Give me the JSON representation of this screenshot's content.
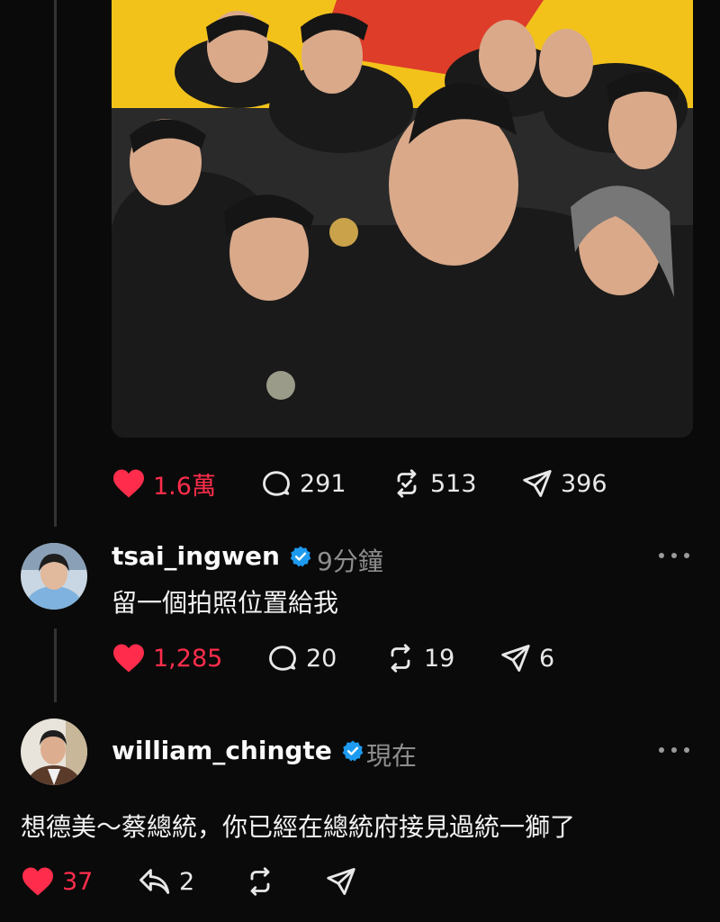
{
  "post": {
    "photo_alt_icon": "group-selfie-photo",
    "actions": {
      "likes": "1.6萬",
      "replies": "291",
      "reposts": "513",
      "shares": "396"
    }
  },
  "replies": [
    {
      "username": "tsai_ingwen",
      "verified": true,
      "time": "9分鐘",
      "text": "留一個拍照位置給我",
      "actions": {
        "likes": "1,285",
        "replies": "20",
        "reposts": "19",
        "shares": "6"
      }
    },
    {
      "username": "william_chingte",
      "verified": true,
      "time": "現在",
      "text": "想德美～蔡總統，你已經在總統府接見過統一獅了",
      "actions": {
        "likes": "37",
        "quotes": "2"
      }
    }
  ],
  "colors": {
    "like": "#ff2d4b",
    "verified": "#1d9bf0",
    "muted": "#8e8e8e"
  }
}
